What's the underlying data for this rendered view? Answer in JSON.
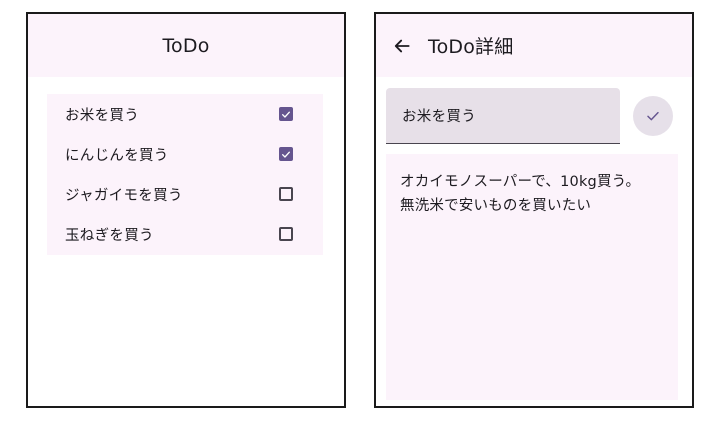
{
  "list_screen": {
    "title": "ToDo",
    "items": [
      {
        "label": "お米を買う",
        "checked": true
      },
      {
        "label": "にんじんを買う",
        "checked": true
      },
      {
        "label": "ジャガイモを買う",
        "checked": false
      },
      {
        "label": "玉ねぎを買う",
        "checked": false
      }
    ]
  },
  "detail_screen": {
    "back_icon": "arrow-back-icon",
    "title": "ToDo詳細",
    "title_field_value": "お米を買う",
    "save_icon": "check-icon",
    "description": "オカイモノスーパーで、10kg買う。\n無洗米で安いものを買いたい"
  },
  "colors": {
    "surface": "#fcf3fb",
    "primary": "#65558f",
    "field": "#e7e0e8",
    "on_surface": "#1d1b20"
  }
}
